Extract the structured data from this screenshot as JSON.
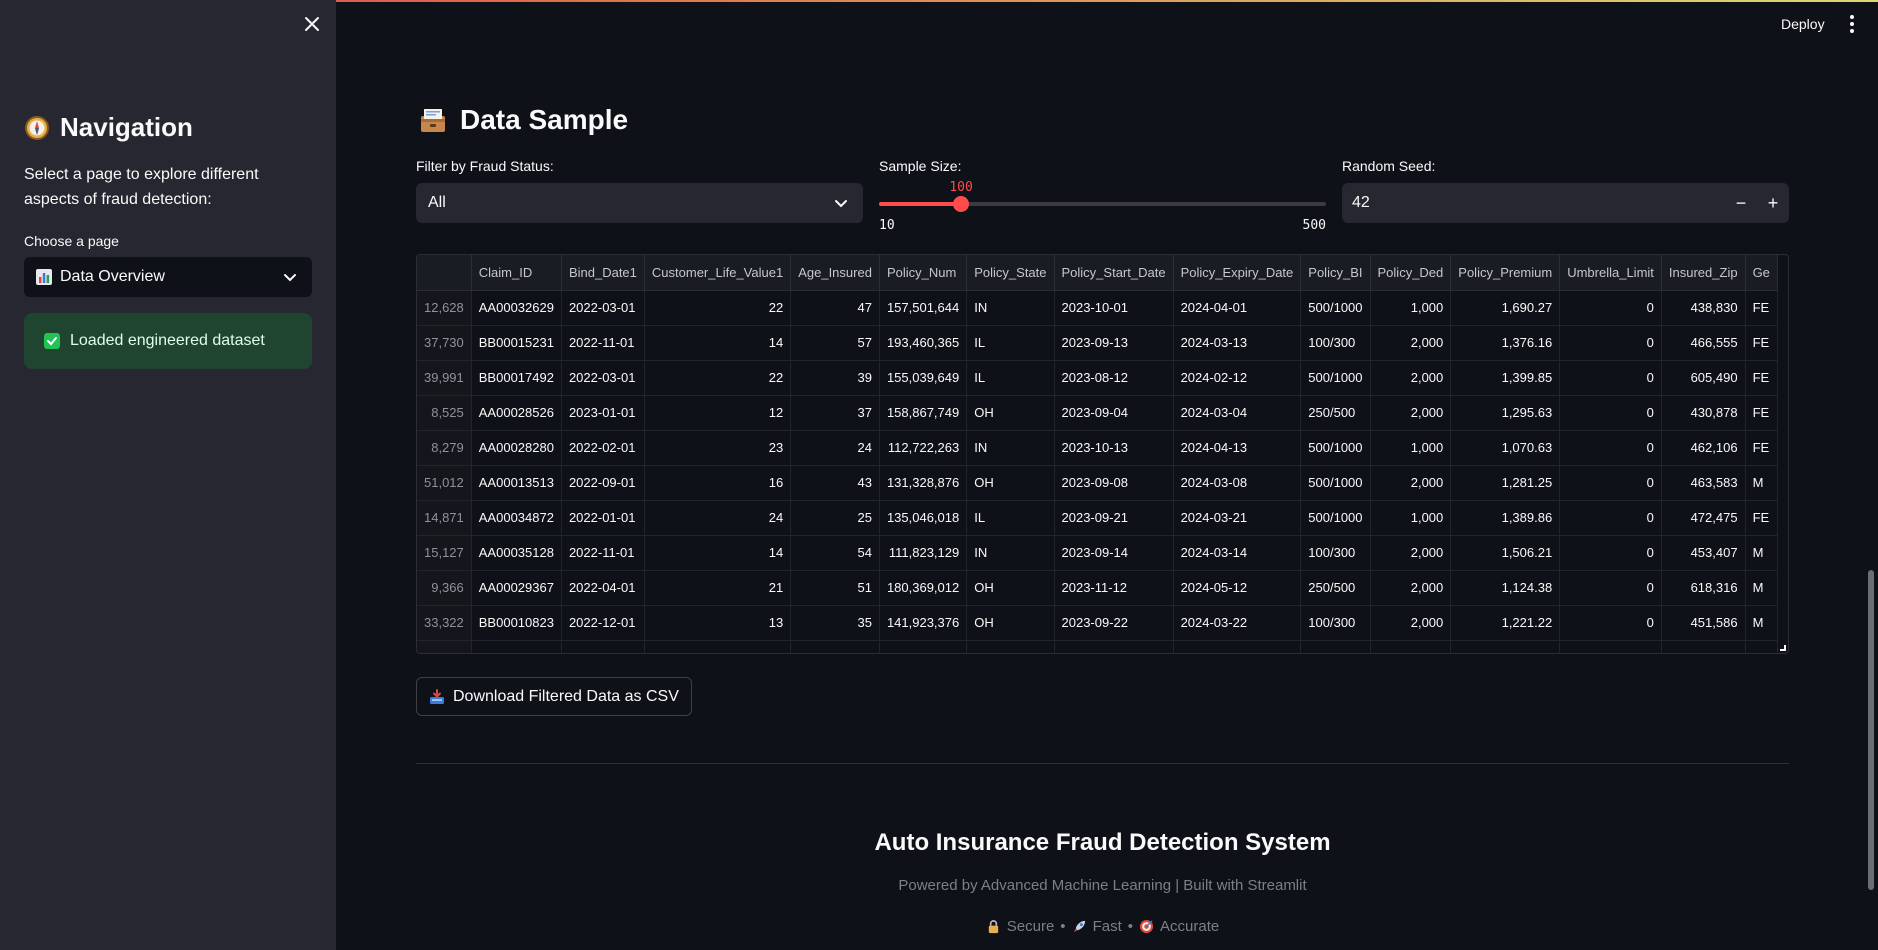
{
  "sidebar": {
    "title": "Navigation",
    "title_icon": "compass-icon",
    "description": "Select a page to explore different aspects of fraud detection:",
    "choose_label": "Choose a page",
    "page_select": {
      "value": "Data Overview",
      "icon": "bar-chart-icon"
    },
    "success_message": "Loaded engineered dataset"
  },
  "header": {
    "deploy_label": "Deploy"
  },
  "main": {
    "title": "Data Sample",
    "title_icon": "card-file-box-icon",
    "filter": {
      "label": "Filter by Fraud Status:",
      "value": "All"
    },
    "sample_size": {
      "label": "Sample Size:",
      "value": 100,
      "min": 10,
      "max": 500,
      "value_text": "100",
      "min_text": "10",
      "max_text": "500"
    },
    "random_seed": {
      "label": "Random Seed:",
      "value": "42",
      "minus": "−",
      "plus": "+"
    },
    "table": {
      "columns": [
        "",
        "Claim_ID",
        "Bind_Date1",
        "Customer_Life_Value1",
        "Age_Insured",
        "Policy_Num",
        "Policy_State",
        "Policy_Start_Date",
        "Policy_Expiry_Date",
        "Policy_BI",
        "Policy_Ded",
        "Policy_Premium",
        "Umbrella_Limit",
        "Insured_Zip",
        "Ge"
      ],
      "rows": [
        [
          "12,628",
          "AA00032629",
          "2022-03-01",
          "22",
          "47",
          "157,501,644",
          "IN",
          "2023-10-01",
          "2024-04-01",
          "500/1000",
          "1,000",
          "1,690.27",
          "0",
          "438,830",
          "FE"
        ],
        [
          "37,730",
          "BB00015231",
          "2022-11-01",
          "14",
          "57",
          "193,460,365",
          "IL",
          "2023-09-13",
          "2024-03-13",
          "100/300",
          "2,000",
          "1,376.16",
          "0",
          "466,555",
          "FE"
        ],
        [
          "39,991",
          "BB00017492",
          "2022-03-01",
          "22",
          "39",
          "155,039,649",
          "IL",
          "2023-08-12",
          "2024-02-12",
          "500/1000",
          "2,000",
          "1,399.85",
          "0",
          "605,490",
          "FE"
        ],
        [
          "8,525",
          "AA00028526",
          "2023-01-01",
          "12",
          "37",
          "158,867,749",
          "OH",
          "2023-09-04",
          "2024-03-04",
          "250/500",
          "2,000",
          "1,295.63",
          "0",
          "430,878",
          "FE"
        ],
        [
          "8,279",
          "AA00028280",
          "2022-02-01",
          "23",
          "24",
          "112,722,263",
          "IN",
          "2023-10-13",
          "2024-04-13",
          "500/1000",
          "1,000",
          "1,070.63",
          "0",
          "462,106",
          "FE"
        ],
        [
          "51,012",
          "AA00013513",
          "2022-09-01",
          "16",
          "43",
          "131,328,876",
          "OH",
          "2023-09-08",
          "2024-03-08",
          "500/1000",
          "2,000",
          "1,281.25",
          "0",
          "463,583",
          "M"
        ],
        [
          "14,871",
          "AA00034872",
          "2022-01-01",
          "24",
          "25",
          "135,046,018",
          "IL",
          "2023-09-21",
          "2024-03-21",
          "500/1000",
          "1,000",
          "1,389.86",
          "0",
          "472,475",
          "FE"
        ],
        [
          "15,127",
          "AA00035128",
          "2022-11-01",
          "14",
          "54",
          "111,823,129",
          "IN",
          "2023-09-14",
          "2024-03-14",
          "100/300",
          "2,000",
          "1,506.21",
          "0",
          "453,407",
          "M"
        ],
        [
          "9,366",
          "AA00029367",
          "2022-04-01",
          "21",
          "51",
          "180,369,012",
          "OH",
          "2023-11-12",
          "2024-05-12",
          "250/500",
          "2,000",
          "1,124.38",
          "0",
          "618,316",
          "M"
        ],
        [
          "33,322",
          "BB00010823",
          "2022-12-01",
          "13",
          "35",
          "141,923,376",
          "OH",
          "2023-09-22",
          "2024-03-22",
          "100/300",
          "2,000",
          "1,221.22",
          "0",
          "451,586",
          "M"
        ]
      ]
    },
    "download_button": {
      "label": "Download Filtered Data as CSV",
      "icon": "inbox-tray-icon"
    }
  },
  "footer": {
    "title": "Auto Insurance Fraud Detection System",
    "subtitle": "Powered by Advanced Machine Learning | Built with Streamlit",
    "tags": [
      {
        "icon": "lock-icon",
        "label": "Secure"
      },
      {
        "icon": "rocket-icon",
        "label": "Fast"
      },
      {
        "icon": "target-icon",
        "label": "Accurate"
      }
    ],
    "separator": "•"
  },
  "colors": {
    "accent": "#ff4b4b",
    "success_bg": "#1f4430",
    "background": "#0e1117",
    "sidebar_bg": "#262730"
  }
}
